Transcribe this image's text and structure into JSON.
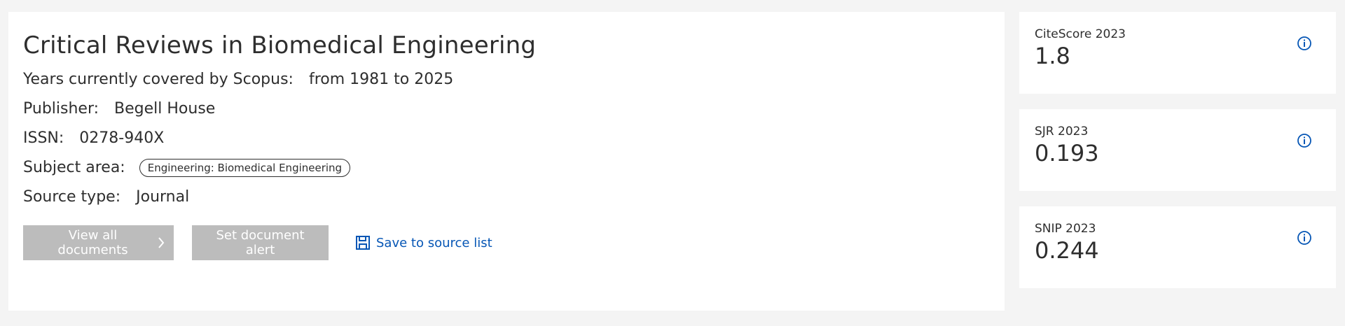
{
  "source": {
    "title": "Critical Reviews in Biomedical Engineering",
    "years_label": "Years currently covered by Scopus:",
    "years_value": "from 1981 to 2025",
    "publisher_label": "Publisher:",
    "publisher_value": "Begell House",
    "issn_label": "ISSN:",
    "issn_value": "0278-940X",
    "subject_label": "Subject area:",
    "subject_value": "Engineering: Biomedical Engineering",
    "type_label": "Source type:",
    "type_value": "Journal"
  },
  "actions": {
    "view_all_label": "View all documents",
    "alert_label": "Set document alert",
    "save_label": "Save to source list"
  },
  "metrics": [
    {
      "label": "CiteScore 2023",
      "value": "1.8"
    },
    {
      "label": "SJR 2023",
      "value": "0.193"
    },
    {
      "label": "SNIP 2023",
      "value": "0.244"
    }
  ],
  "icons": {
    "chevron": "chevron-right-icon",
    "save": "save-icon",
    "info": "info-icon"
  },
  "colors": {
    "link": "#0656b5",
    "button_disabled": "#bcbcbc",
    "text": "#2e2e2e",
    "background": "#f4f4f4"
  }
}
